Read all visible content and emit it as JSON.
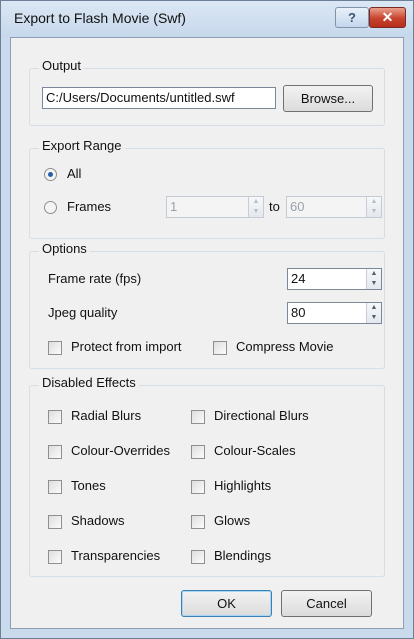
{
  "window": {
    "title": "Export to Flash Movie (Swf)",
    "help_glyph": "?",
    "close_glyph": "✕"
  },
  "output": {
    "legend": "Output",
    "path": "C:/Users/Documents/untitled.swf",
    "browse_label": "Browse..."
  },
  "export_range": {
    "legend": "Export Range",
    "all_label": "All",
    "all_selected": true,
    "frames_label": "Frames",
    "from_value": "1",
    "to_label": "to",
    "to_value": "60"
  },
  "options": {
    "legend": "Options",
    "frame_rate_label": "Frame rate (fps)",
    "frame_rate_value": "24",
    "jpeg_quality_label": "Jpeg quality",
    "jpeg_quality_value": "80",
    "protect_label": "Protect from import",
    "compress_label": "Compress Movie"
  },
  "disabled_effects": {
    "legend": "Disabled Effects",
    "left": [
      "Radial Blurs",
      "Colour-Overrides",
      "Tones",
      "Shadows",
      "Transparencies"
    ],
    "right": [
      "Directional Blurs",
      "Colour-Scales",
      "Highlights",
      "Glows",
      "Blendings"
    ]
  },
  "buttons": {
    "ok": "OK",
    "cancel": "Cancel"
  },
  "colors": {
    "title_bar": "#c9daed",
    "close_button": "#c8432d",
    "radio_dot": "#2a5ea8"
  }
}
